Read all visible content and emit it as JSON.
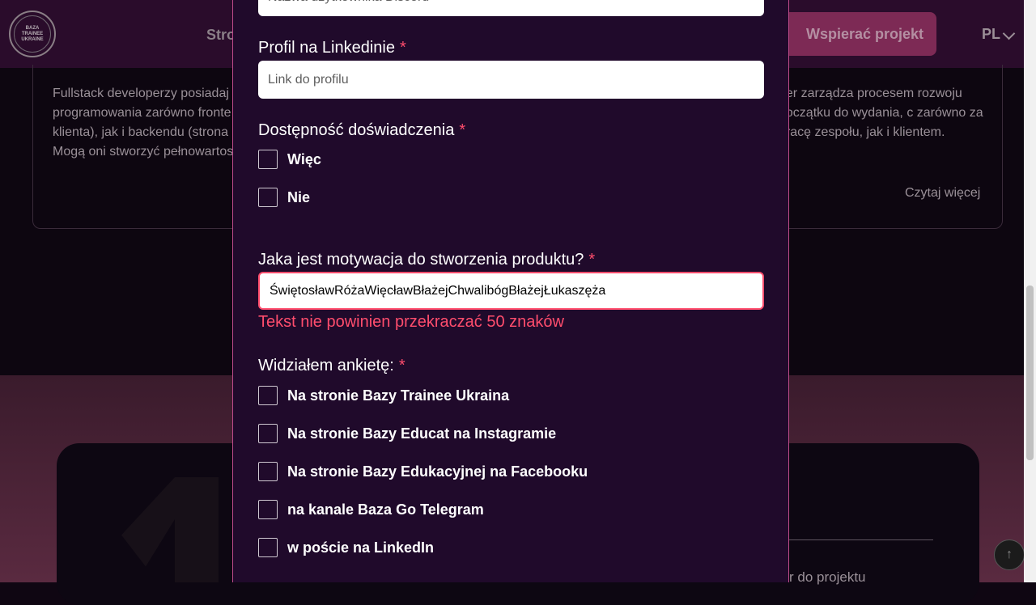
{
  "header": {
    "logo_lines": [
      "BAZA",
      "TRAINEE",
      "UKRAINE"
    ],
    "nav_partial": "Stro",
    "support_button": "Wspierać projekt",
    "language": "PL"
  },
  "background_cards": {
    "left_text": "Fullstack developerzy posiadaj programowania zarówno fronte klienta), jak i backendu (strona Mogą oni stworzyć pełnowartos",
    "right_text": "ger zarządza procesem rozwoju początku do wydania, c zarówno za pracę zespołu, jak i klientem.",
    "read_more": "Czytaj więcej",
    "lower_text": "r do projektu"
  },
  "form": {
    "discord_placeholder": "Nazwa użytkownika Discord",
    "linkedin_label": "Profil na Linkedinie",
    "linkedin_placeholder": "Link do profilu",
    "experience_label": "Dostępność doświadczenia",
    "experience_options": [
      "Więc",
      "Nie"
    ],
    "motivation_label": "Jaka jest motywacja do stworzenia produktu?",
    "motivation_value": "ŚwiętosławRóżaWięcławBłażejChwalibógBłażejŁukaszęża",
    "motivation_error": "Tekst nie powinien przekraczać 50 znaków",
    "survey_label": "Widziałem ankietę:",
    "survey_options": [
      "Na stronie Bazy Trainee Ukraina",
      "Na stronie Bazy Educat na Instagramie",
      "Na stronie Bazy Edukacyjnej na Facebooku",
      "na kanale Baza Go Telegram",
      "w poście na LinkedIn"
    ],
    "required_mark": "*"
  },
  "colors": {
    "modal_bg": "#200a2b",
    "error": "#ff4d6d",
    "accent_border": "#bc4b8a"
  }
}
